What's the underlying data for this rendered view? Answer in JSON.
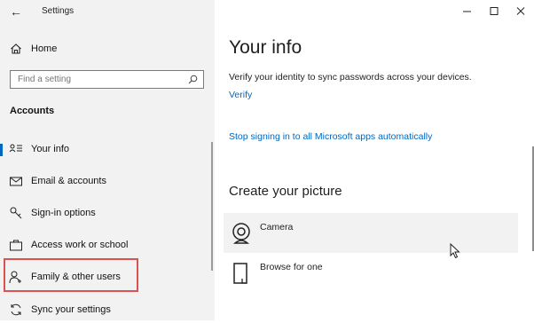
{
  "window": {
    "title": "Settings"
  },
  "sidebar": {
    "home_label": "Home",
    "search_placeholder": "Find a setting",
    "section_title": "Accounts",
    "items": [
      {
        "label": "Your info"
      },
      {
        "label": "Email & accounts"
      },
      {
        "label": "Sign-in options"
      },
      {
        "label": "Access work or school"
      },
      {
        "label": "Family & other users"
      },
      {
        "label": "Sync your settings"
      }
    ]
  },
  "main": {
    "title": "Your info",
    "verify_text": "Verify your identity to sync passwords across your devices.",
    "verify_link": "Verify",
    "stop_link": "Stop signing in to all Microsoft apps automatically",
    "picture_title": "Create your picture",
    "picture_options": [
      {
        "label": "Camera",
        "icon": "camera-icon"
      },
      {
        "label": "Browse for one",
        "icon": "browse-file-icon"
      }
    ]
  },
  "colors": {
    "accent": "#0067c0",
    "highlight": "#d9534f",
    "sidebar_bg": "#f2f2f2"
  }
}
